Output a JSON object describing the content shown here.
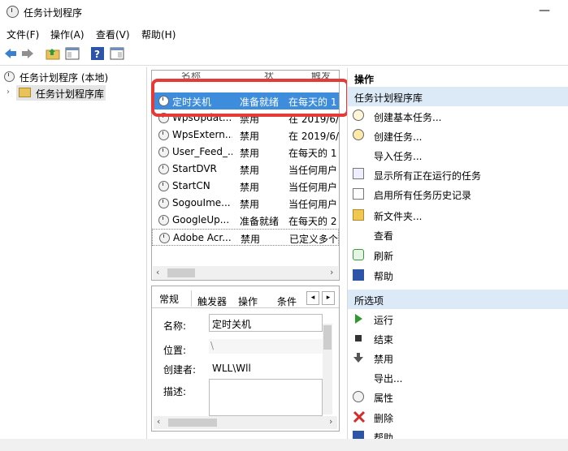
{
  "window": {
    "title": "任务计划程序",
    "minimize": "—"
  },
  "menu": [
    "文件(F)",
    "操作(A)",
    "查看(V)",
    "帮助(H)"
  ],
  "tree": {
    "root": "任务计划程序 (本地)",
    "child": "任务计划程序库"
  },
  "table": {
    "header_partial": [
      "名称",
      "状",
      "触发"
    ],
    "rows": [
      {
        "name": "定时关机",
        "status": "准备就绪",
        "trigger": "在每天的 1"
      },
      {
        "name": "WpsUpdat...",
        "status": "禁用",
        "trigger": "在 2019/6/"
      },
      {
        "name": "WpsExtern...",
        "status": "禁用",
        "trigger": "在 2019/6/"
      },
      {
        "name": "User_Feed_...",
        "status": "禁用",
        "trigger": "在每天的 1"
      },
      {
        "name": "StartDVR",
        "status": "禁用",
        "trigger": "当任何用户"
      },
      {
        "name": "StartCN",
        "status": "禁用",
        "trigger": "当任何用户"
      },
      {
        "name": "SogouIme...",
        "status": "禁用",
        "trigger": "当任何用户"
      },
      {
        "name": "GoogleUp...",
        "status": "准备就绪",
        "trigger": "在每天的 2"
      },
      {
        "name": "Adobe Acr...",
        "status": "禁用",
        "trigger": "已定义多个"
      }
    ]
  },
  "detail": {
    "tabs": [
      "常规",
      "触发器",
      "操作",
      "条件"
    ],
    "labels": {
      "name": "名称:",
      "location": "位置:",
      "author": "创建者:",
      "desc": "描述:"
    },
    "values": {
      "name": "定时关机",
      "location": "\\",
      "author": "WLL\\Wll"
    }
  },
  "actions": {
    "header": "操作",
    "section1": "任务计划程序库",
    "items1": [
      "创建基本任务...",
      "创建任务...",
      "导入任务...",
      "显示所有正在运行的任务",
      "启用所有任务历史记录",
      "新文件夹...",
      "查看",
      "刷新",
      "帮助"
    ],
    "section2": "所选项",
    "items2": [
      "运行",
      "结束",
      "禁用",
      "导出...",
      "属性",
      "删除",
      "帮助"
    ]
  },
  "colors": {
    "selection": "#3e8ddd",
    "section_bg": "#dce9f7",
    "highlight": "#e53a35"
  }
}
